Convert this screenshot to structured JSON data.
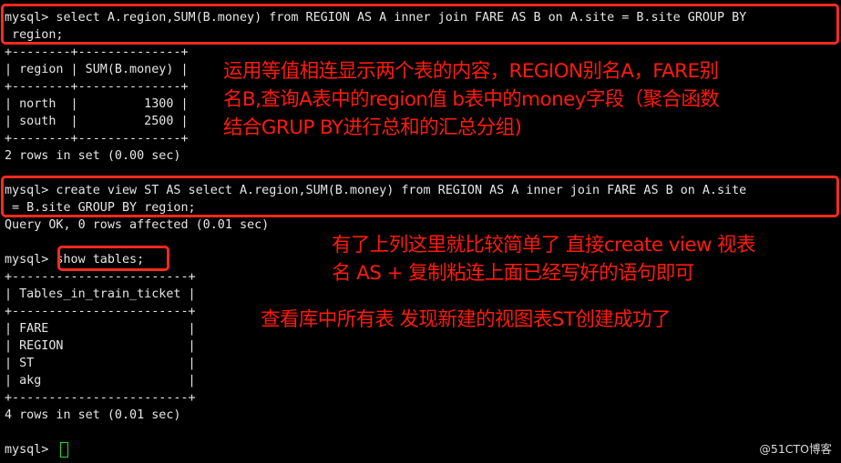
{
  "terminal": {
    "lines": {
      "l01": "mysql> select A.region,SUM(B.money) from REGION AS A inner join FARE AS B on A.site = B.site GROUP BY",
      "l02": " region;",
      "l03": "+--------+--------------+",
      "l04": "| region | SUM(B.money) |",
      "l05": "+--------+--------------+",
      "l06": "| north  |         1300 |",
      "l07": "| south  |         2500 |",
      "l08": "+--------+--------------+",
      "l09": "2 rows in set (0.00 sec)",
      "l10": "mysql> create view ST AS select A.region,SUM(B.money) from REGION AS A inner join FARE AS B on A.site",
      "l11": " = B.site GROUP BY region;",
      "l12": "Query OK, 0 rows affected (0.01 sec)",
      "l13_prompt": "mysql> ",
      "l13_cmd": "show tables;",
      "l14": "+------------------------+",
      "l15": "| Tables_in_train_ticket |",
      "l16": "+------------------------+",
      "l17": "| FARE                   |",
      "l18": "| REGION                 |",
      "l19": "| ST                     |",
      "l20": "| akg                    |",
      "l21": "+------------------------+",
      "l22": "4 rows in set (0.01 sec)",
      "l23": "mysql> "
    },
    "result_table_1": {
      "columns": [
        "region",
        "SUM(B.money)"
      ],
      "rows": [
        [
          "north",
          "1300"
        ],
        [
          "south",
          "2500"
        ]
      ]
    },
    "result_table_2": {
      "columns": [
        "Tables_in_train_ticket"
      ],
      "rows": [
        [
          "FARE"
        ],
        [
          "REGION"
        ],
        [
          "ST"
        ],
        [
          "akg"
        ]
      ]
    }
  },
  "annotations": {
    "note1": [
      "运用等值相连显示两个表的内容，REGION别名A，FARE别",
      "名B,查询A表中的region值 b表中的money字段（聚合函数",
      "结合GRUP BY进行总和的汇总分组)"
    ],
    "note2": [
      "有了上列这里就比较简单了 直接create view 视表",
      "名 AS + 复制粘连上面已经写好的语句即可"
    ],
    "note3": "查看库中所有表 发现新建的视图表ST创建成功了",
    "highlight_color": "#ff2a1f",
    "cursor_color": "#22e022"
  },
  "watermark": "@51CTO博客"
}
